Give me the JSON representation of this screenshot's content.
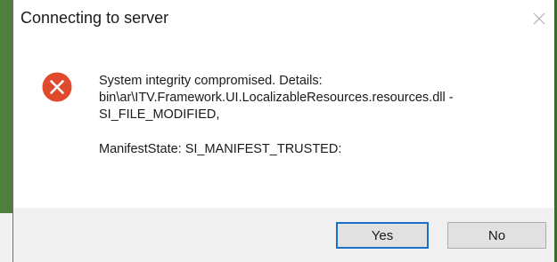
{
  "dialog": {
    "title": "Connecting to server",
    "close_icon": "close-icon",
    "error_icon": "error-icon",
    "message_line1": "System integrity compromised. Details:",
    "message_line2": "bin\\ar\\ITV.Framework.UI.LocalizableResources.resources.dll -",
    "message_line3": "SI_FILE_MODIFIED,",
    "message_manifest": "ManifestState: SI_MANIFEST_TRUSTED:",
    "buttons": {
      "yes_label": "Yes",
      "no_label": "No"
    },
    "colors": {
      "error_red": "#e04a2c",
      "focus_blue": "#1a6fc7"
    }
  }
}
